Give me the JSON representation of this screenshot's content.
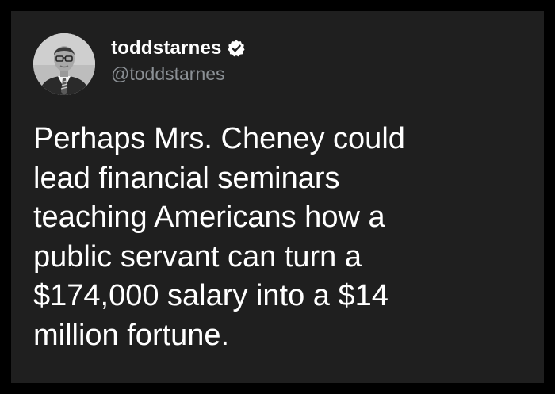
{
  "author": {
    "display_name": "toddstarnes",
    "username": "@toddstarnes",
    "verified": true,
    "avatar_icon": "profile-photo-icon",
    "verified_icon": "verified-badge-icon"
  },
  "tweet": {
    "text": "Perhaps Mrs. Cheney could\nlead financial seminars\nteaching Americans how a\npublic servant can turn a\n$174,000 salary into a $14\nmillion fortune."
  },
  "colors": {
    "page_border": "#000000",
    "card_background": "#1f1f1f",
    "text_primary": "#ffffff",
    "text_secondary": "#8b9095"
  }
}
